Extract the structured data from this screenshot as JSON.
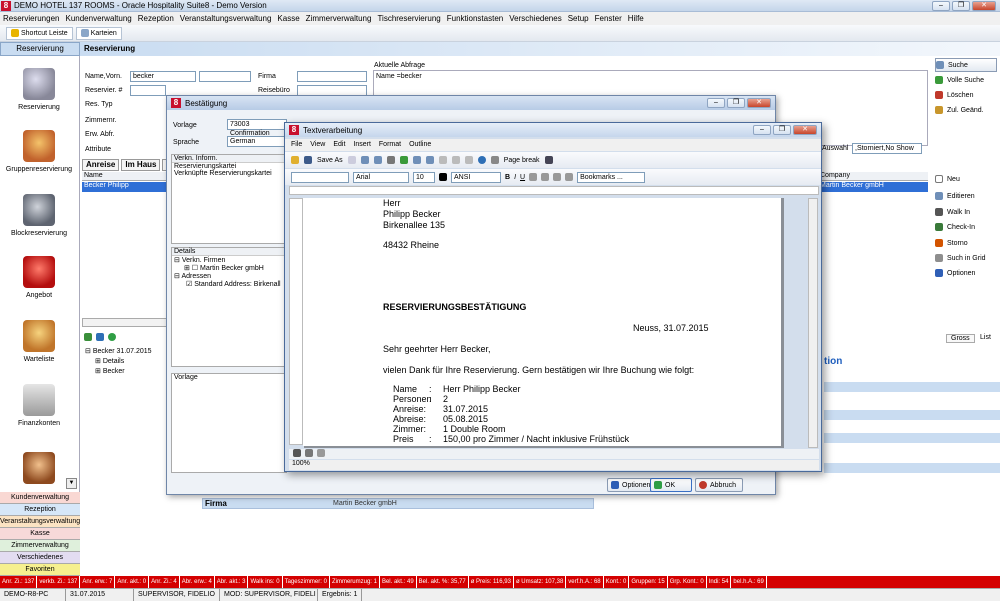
{
  "app": {
    "title": "DEMO HOTEL 137 ROOMS - Oracle Hospitality Suite8 - Demo Version",
    "menu": [
      "Reservierungen",
      "Kundenverwaltung",
      "Rezeption",
      "Veranstaltungsverwaltung",
      "Kasse",
      "Zimmerverwaltung",
      "Tischreservierung",
      "Funktionstasten",
      "Verschiedenes",
      "Setup",
      "Fenster",
      "Hilfe"
    ]
  },
  "toolbar": {
    "shortcut": "Shortcut Leiste",
    "karteien": "Karteien"
  },
  "nav": {
    "header": "Reservierung",
    "items": [
      "Reservierung",
      "Gruppenreservierung",
      "Blockreservierung",
      "Angebot",
      "Warteliste",
      "Finanzkonten"
    ],
    "bottom": [
      "Kundenverwaltung",
      "Rezeption",
      "Veranstaltungsverwaltung",
      "Kasse",
      "Zimmerverwaltung",
      "Verschiedenes",
      "Favoriten"
    ]
  },
  "reservation": {
    "title": "Reservierung",
    "labels": {
      "name": "Name,Vorn.",
      "reservier": "Reservier. #",
      "restyp": "Res. Typ",
      "zimmernr": "Zimmernr.",
      "erw": "Erw. Abfr.",
      "attribute": "Attribute",
      "firma": "Firma",
      "reiseburo": "Reisebüro",
      "aktuelle": "Aktuelle Abfrage"
    },
    "name_value": "becker",
    "query": "Name =becker",
    "tabs": [
      "Anreise",
      "Im Haus",
      "Ab"
    ],
    "col_name": "Name",
    "col_company": "Company",
    "row_name": "Becker Philipp",
    "row_company": "Martin Becker gmbH",
    "auswahl": "Auswahl",
    "auswahl_value": ",Storniert,No Show",
    "tree": [
      "Becker 31.07.2015",
      "Details",
      "Becker"
    ],
    "tabs_right": [
      "Gross",
      "List"
    ],
    "firma_label": "Firma",
    "firma_value": "Martin Becker gmbH",
    "ion": "tion"
  },
  "right_buttons": [
    "Suche",
    "Volle Suche",
    "Löschen",
    "Zul. Geänd.",
    "Neu",
    "Editieren",
    "Walk In",
    "Check-In",
    "Storno",
    "Such in Grid",
    "Optionen"
  ],
  "bestaetigung": {
    "title": "Bestätigung",
    "vorlage_label": "Vorlage",
    "vorlage_value": "73003 Confirmation",
    "sprache_label": "Sprache",
    "sprache_value": "German",
    "verkn_header": "Verkn. Inform.",
    "verkn_rows": [
      "Reservierungskartei",
      "Verknüpfte Reservierungskartei"
    ],
    "details_header": "Details",
    "tree": [
      "Verkn. Firmen",
      "Martin Becker gmbH",
      "Adressen",
      "Standard Address: Birkenall"
    ],
    "vorlage_section": "Vorlage",
    "buttons": {
      "optionen": "Optionen",
      "ok": "OK",
      "abbruch": "Abbruch"
    }
  },
  "editor": {
    "title": "Textverarbeitung",
    "menu": [
      "File",
      "View",
      "Edit",
      "Insert",
      "Format",
      "Outline"
    ],
    "save_as": "Save As",
    "page_break": "Page break",
    "font": "Arial",
    "size": "10",
    "charset": "ANSI",
    "bookmarks": "Bookmarks ...",
    "zoom": "100%",
    "document": {
      "salutation": "Herr",
      "name": "Philipp Becker",
      "street": "Birkenallee 135",
      "city": "48432 Rheine",
      "heading": "RESERVIERUNGSBESTÄTIGUNG",
      "place_date": "Neuss, 31.07.2015",
      "greeting": "Sehr geehrter Herr Becker,",
      "intro": "vielen Dank für Ihre Reservierung. Gern bestätigen wir Ihre Buchung wie folgt:",
      "details": [
        {
          "label": "Name",
          "sep": ":",
          "value": "Herr Philipp Becker"
        },
        {
          "label": "Personen",
          "sep": ":",
          "value": "2"
        },
        {
          "label": "Anreise:",
          "sep": "",
          "value": "31.07.2015"
        },
        {
          "label": "Abreise:",
          "sep": "",
          "value": "05.08.2015"
        },
        {
          "label": "Zimmer:",
          "sep": "",
          "value": "1 Double Room"
        },
        {
          "label": "Preis",
          "sep": ":",
          "value": "150,00 pro Zimmer / Nacht inklusive Frühstück"
        }
      ]
    }
  },
  "status": [
    "Anr. Zi.: 137",
    "verkb. Zi.: 137",
    "Anr. erw.: 7",
    "Anr. akt.: 0",
    "Anr. Zi.: 4",
    "Abr. erw.: 4",
    "Abr. akt.: 3",
    "Walk ins: 0",
    "Tageszimmer: 0",
    "Zimmerumzug: 1",
    "Bel. akt.: 49",
    "Bel. akt. %: 35,77",
    "ø Preis: 116,93",
    "ø Umsatz: 107,38",
    "verf.h.A.: 68",
    "Kont.: 0",
    "Gruppen: 15",
    "Grp. Kont.: 0",
    "Indi: 54",
    "bel.h.A.: 69"
  ],
  "bottom": [
    "DEMO-R8-PC",
    "31.07.2015",
    "SUPERVISOR, FIDELIO",
    "MOD: SUPERVISOR, FIDELI",
    "Ergebnis: 1"
  ],
  "colors": {
    "status_bg": "#d40000",
    "nav_header": "#c9dcf1",
    "accent": "#1f5fbf"
  }
}
